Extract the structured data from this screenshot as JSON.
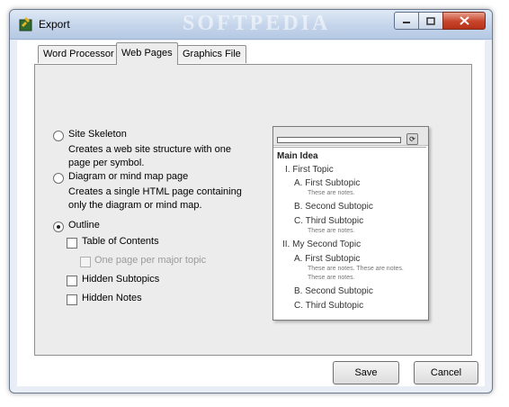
{
  "window": {
    "title": "Export",
    "watermark": "SOFTPEDIA"
  },
  "tabs": [
    {
      "label": "Word Processor"
    },
    {
      "label": "Web Pages"
    },
    {
      "label": "Graphics File"
    }
  ],
  "options": {
    "site_skeleton": {
      "label": "Site Skeleton",
      "desc1": "Creates a web site structure with one",
      "desc2": "page per symbol."
    },
    "diagram_page": {
      "label": "Diagram or mind map page",
      "desc1": "Creates a single HTML page containing",
      "desc2": "only the diagram or mind map."
    },
    "outline": {
      "label": "Outline"
    },
    "table_of_contents": {
      "label": "Table of Contents"
    },
    "one_page_per_topic": {
      "label": "One page per major topic"
    },
    "hidden_subtopics": {
      "label": "Hidden Subtopics"
    },
    "hidden_notes": {
      "label": "Hidden Notes"
    }
  },
  "preview": {
    "lines": [
      {
        "text": "Main Idea"
      },
      {
        "text": "I. First Topic"
      },
      {
        "text": "A. First Subtopic"
      },
      {
        "text": "These are notes."
      },
      {
        "text": "B. Second Subtopic"
      },
      {
        "text": "C. Third Subtopic"
      },
      {
        "text": "These are notes."
      },
      {
        "text": "II. My Second Topic"
      },
      {
        "text": "A. First Subtopic"
      },
      {
        "text": "These are notes. These are notes."
      },
      {
        "text": "These are notes."
      },
      {
        "text": "B. Second Subtopic"
      },
      {
        "text": "C. Third Subtopic"
      }
    ]
  },
  "buttons": {
    "save": "Save",
    "cancel": "Cancel"
  },
  "colors": {
    "title_bar": "#c4d4ea",
    "close_button": "#c7432a",
    "panel": "#ececec"
  }
}
